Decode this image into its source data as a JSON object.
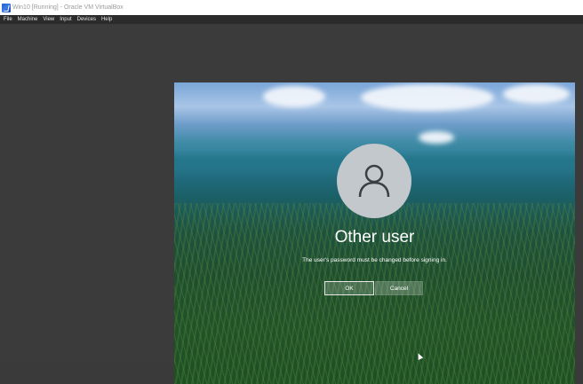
{
  "window": {
    "title": "Win10 [Running] - Oracle VM VirtualBox",
    "icon": "virtualbox-icon"
  },
  "menu": {
    "items": [
      "File",
      "Machine",
      "View",
      "Input",
      "Devices",
      "Help"
    ]
  },
  "login": {
    "avatar_icon": "user-avatar-icon",
    "username": "Other user",
    "message": "The user's password must be changed before signing in.",
    "ok_label": "OK",
    "cancel_label": "Cancel"
  }
}
